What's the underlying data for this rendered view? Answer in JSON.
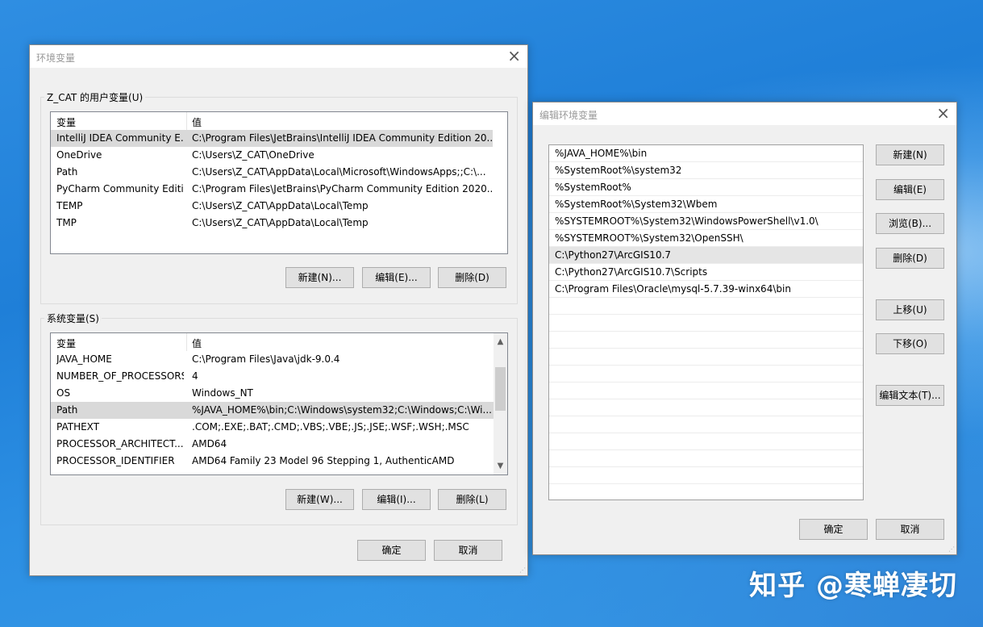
{
  "env_dialog": {
    "title": "环境变量",
    "user_group_label": "Z_CAT 的用户变量(U)",
    "system_group_label": "系统变量(S)",
    "columns": [
      "变量",
      "值"
    ],
    "user_vars": [
      {
        "name": "IntelliJ IDEA Community E...",
        "value": "C:\\Program Files\\JetBrains\\IntelliJ IDEA Community Edition 20..."
      },
      {
        "name": "OneDrive",
        "value": "C:\\Users\\Z_CAT\\OneDrive"
      },
      {
        "name": "Path",
        "value": "C:\\Users\\Z_CAT\\AppData\\Local\\Microsoft\\WindowsApps;;C:\\..."
      },
      {
        "name": "PyCharm Community Editi...",
        "value": "C:\\Program Files\\JetBrains\\PyCharm Community Edition 2020...."
      },
      {
        "name": "TEMP",
        "value": "C:\\Users\\Z_CAT\\AppData\\Local\\Temp"
      },
      {
        "name": "TMP",
        "value": "C:\\Users\\Z_CAT\\AppData\\Local\\Temp"
      }
    ],
    "system_vars": [
      {
        "name": "JAVA_HOME",
        "value": "C:\\Program Files\\Java\\jdk-9.0.4"
      },
      {
        "name": "NUMBER_OF_PROCESSORS",
        "value": "4"
      },
      {
        "name": "OS",
        "value": "Windows_NT"
      },
      {
        "name": "Path",
        "value": "%JAVA_HOME%\\bin;C:\\Windows\\system32;C:\\Windows;C:\\Wi..."
      },
      {
        "name": "PATHEXT",
        "value": ".COM;.EXE;.BAT;.CMD;.VBS;.VBE;.JS;.JSE;.WSF;.WSH;.MSC"
      },
      {
        "name": "PROCESSOR_ARCHITECT...",
        "value": "AMD64"
      },
      {
        "name": "PROCESSOR_IDENTIFIER",
        "value": "AMD64 Family 23 Model 96 Stepping 1, AuthenticAMD"
      }
    ],
    "user_buttons": {
      "new": "新建(N)...",
      "edit": "编辑(E)...",
      "delete": "删除(D)"
    },
    "system_buttons": {
      "new": "新建(W)...",
      "edit": "编辑(I)...",
      "delete": "删除(L)"
    },
    "ok": "确定",
    "cancel": "取消"
  },
  "edit_dialog": {
    "title": "编辑环境变量",
    "entries": [
      "%JAVA_HOME%\\bin",
      "%SystemRoot%\\system32",
      "%SystemRoot%",
      "%SystemRoot%\\System32\\Wbem",
      "%SYSTEMROOT%\\System32\\WindowsPowerShell\\v1.0\\",
      "%SYSTEMROOT%\\System32\\OpenSSH\\",
      "C:\\Python27\\ArcGIS10.7",
      "C:\\Python27\\ArcGIS10.7\\Scripts",
      "C:\\Program Files\\Oracle\\mysql-5.7.39-winx64\\bin",
      "",
      "",
      "",
      "",
      "",
      "",
      "",
      "",
      "",
      "",
      ""
    ],
    "selected_index": 6,
    "buttons": {
      "new": "新建(N)",
      "edit": "编辑(E)",
      "browse": "浏览(B)...",
      "delete": "删除(D)",
      "up": "上移(U)",
      "down": "下移(O)",
      "edit_text": "编辑文本(T)..."
    },
    "ok": "确定",
    "cancel": "取消"
  },
  "watermark": "知乎 @寒蝉凄切",
  "icons": {
    "close": "close-icon",
    "scroll_up": "chevron-up-icon",
    "scroll_down": "chevron-down-icon",
    "resize": "resize-grip-icon"
  },
  "colors": {
    "desktop": "#1f7fd8",
    "dialog_bg": "#f0f0f0",
    "selected_row": "#d9d9d9"
  }
}
